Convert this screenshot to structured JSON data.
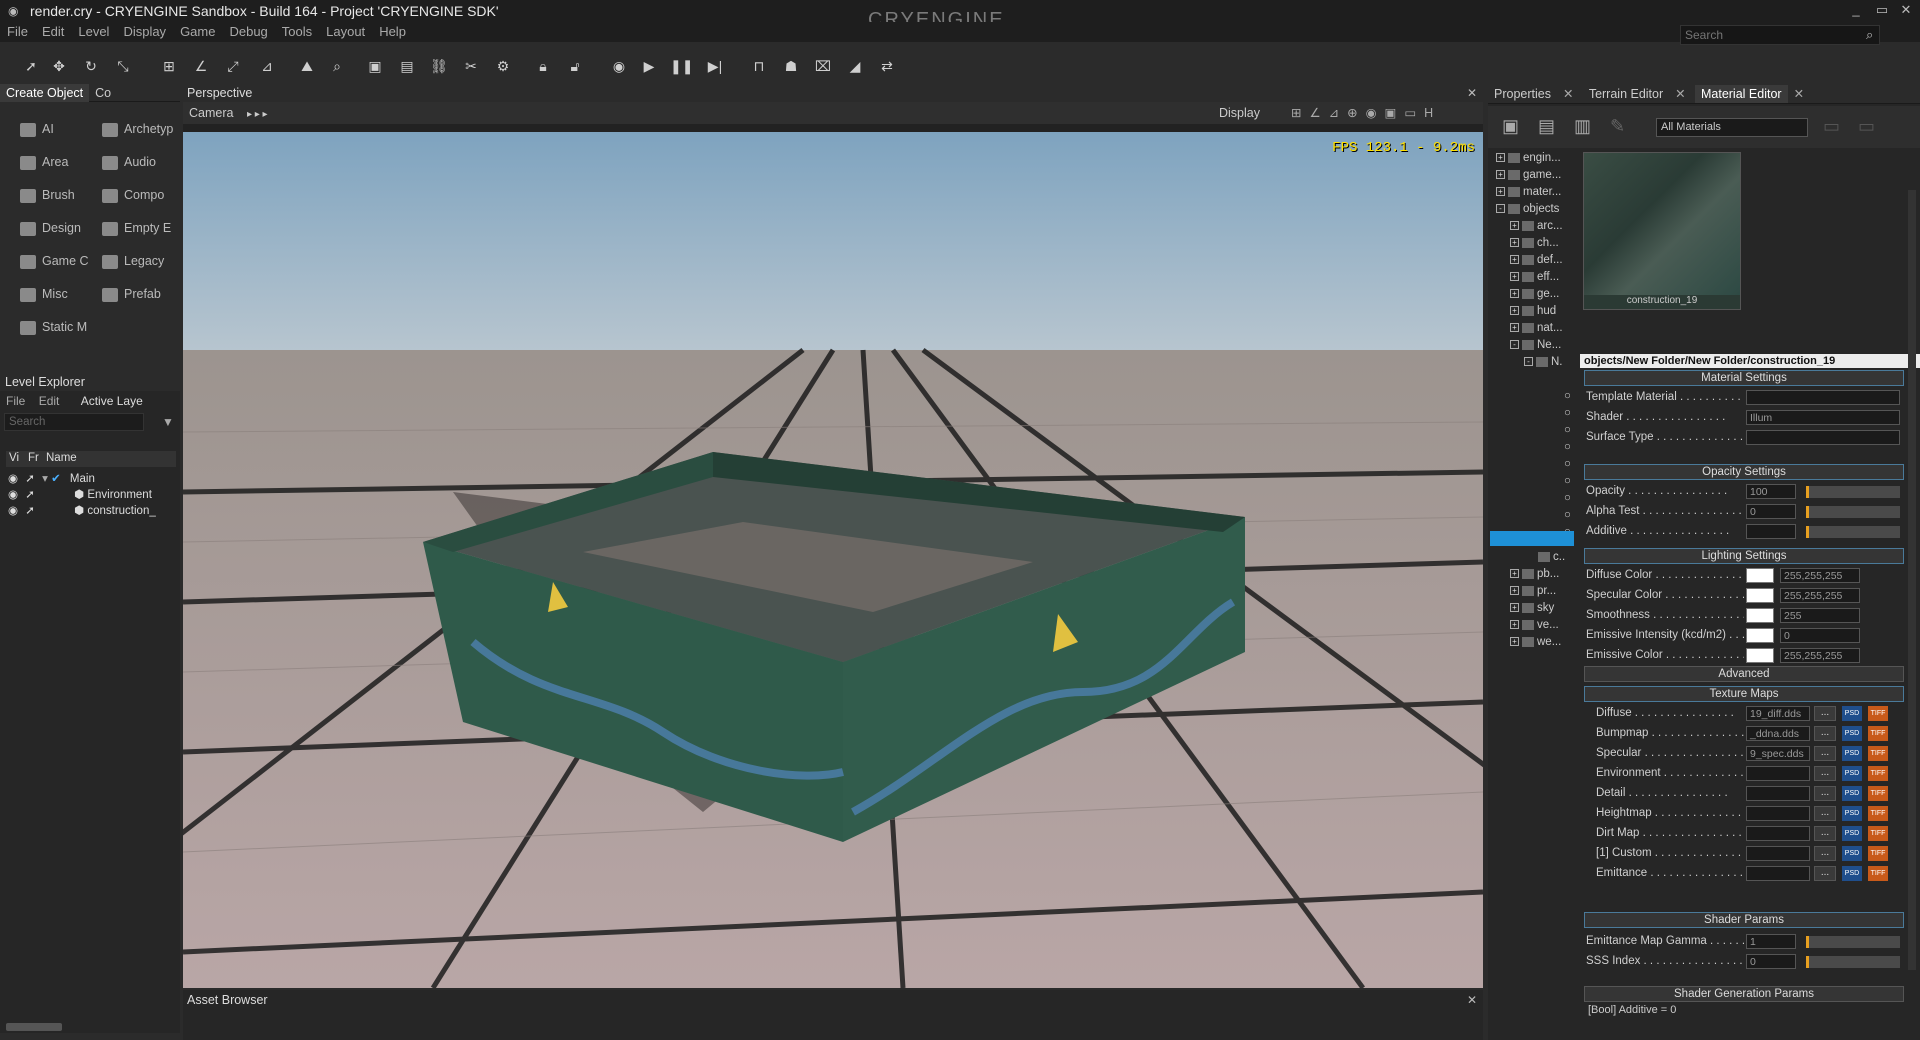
{
  "window": {
    "title": "render.cry - CRYENGINE Sandbox - Build 164 - Project 'CRYENGINE SDK'",
    "logo": "CRYENGINE",
    "minimize": "_",
    "maximize": "▭",
    "close": "✕"
  },
  "menu": [
    "File",
    "Edit",
    "Level",
    "Display",
    "Game",
    "Debug",
    "Tools",
    "Layout",
    "Help"
  ],
  "search": {
    "placeholder": "Search"
  },
  "create_object": {
    "tabs": [
      "Create Object",
      "Co"
    ],
    "items": [
      {
        "label": "AI",
        "icon": "ai-icon"
      },
      {
        "label": "Archetyp",
        "icon": "archetype-icon"
      },
      {
        "label": "Area",
        "icon": "area-icon"
      },
      {
        "label": "Audio",
        "icon": "audio-icon"
      },
      {
        "label": "Brush",
        "icon": "brush-icon"
      },
      {
        "label": "Compo",
        "icon": "component-icon"
      },
      {
        "label": "Design",
        "icon": "designer-icon"
      },
      {
        "label": "Empty E",
        "icon": "empty-entity-icon"
      },
      {
        "label": "Game C",
        "icon": "game-component-icon"
      },
      {
        "label": "Legacy",
        "icon": "legacy-icon"
      },
      {
        "label": "Misc",
        "icon": "misc-icon"
      },
      {
        "label": "Prefab",
        "icon": "prefab-icon"
      },
      {
        "label": "Static M",
        "icon": "static-mesh-icon"
      }
    ]
  },
  "level_explorer": {
    "title": "Level Explorer",
    "menu": [
      "File",
      "Edit"
    ],
    "active_layer": "Active Laye",
    "search_placeholder": "Search",
    "columns": [
      "Vi",
      "Fr",
      "Name"
    ],
    "rows": [
      "Main",
      "Environment",
      "construction_"
    ]
  },
  "viewport": {
    "title": "Perspective",
    "camera": "Camera",
    "display": "Display",
    "fps": "FPS 123.1 - 9.2ms"
  },
  "asset_browser": {
    "title": "Asset Browser"
  },
  "right_panel": {
    "tabs": [
      "Properties",
      "Terrain Editor",
      "Material Editor"
    ],
    "filter": "All Materials",
    "tree": [
      {
        "label": "engin...",
        "level": 0,
        "sign": "+"
      },
      {
        "label": "game...",
        "level": 0,
        "sign": "+"
      },
      {
        "label": "mater...",
        "level": 0,
        "sign": "+"
      },
      {
        "label": "objects",
        "level": 0,
        "sign": "-"
      },
      {
        "label": "arc...",
        "level": 1,
        "sign": "+"
      },
      {
        "label": "ch...",
        "level": 1,
        "sign": "+"
      },
      {
        "label": "def...",
        "level": 1,
        "sign": "+"
      },
      {
        "label": "eff...",
        "level": 1,
        "sign": "+"
      },
      {
        "label": "ge...",
        "level": 1,
        "sign": "+"
      },
      {
        "label": "hud",
        "level": 1,
        "sign": "+"
      },
      {
        "label": "nat...",
        "level": 1,
        "sign": "+"
      },
      {
        "label": "Ne...",
        "level": 1,
        "sign": "-"
      },
      {
        "label": "N.",
        "level": 2,
        "sign": "-"
      }
    ],
    "tree_bottom": [
      {
        "label": "c..",
        "level": 3,
        "sign": ""
      },
      {
        "label": "pb...",
        "level": 1,
        "sign": "+"
      },
      {
        "label": "pr...",
        "level": 1,
        "sign": "+"
      },
      {
        "label": "sky",
        "level": 1,
        "sign": "+"
      },
      {
        "label": "ve...",
        "level": 1,
        "sign": "+"
      },
      {
        "label": "we...",
        "level": 1,
        "sign": "+"
      }
    ],
    "preview_name": "construction_19",
    "material_path": "objects/New Folder/New Folder/construction_19",
    "sections": {
      "material": "Material Settings",
      "opacity": "Opacity Settings",
      "lighting": "Lighting Settings",
      "advanced": "Advanced",
      "texture": "Texture Maps",
      "shader_params": "Shader Params",
      "shader_gen": "Shader Generation Params"
    },
    "material_rows": [
      {
        "label": "Template Material",
        "value": ""
      },
      {
        "label": "Shader",
        "value": "Illum"
      },
      {
        "label": "Surface Type",
        "value": ""
      }
    ],
    "opacity_rows": [
      {
        "label": "Opacity",
        "value": "100"
      },
      {
        "label": "Alpha Test",
        "value": "0"
      },
      {
        "label": "Additive",
        "value": ""
      }
    ],
    "lighting_rows": [
      {
        "label": "Diffuse Color",
        "value": "255,255,255"
      },
      {
        "label": "Specular Color",
        "value": "255,255,255"
      },
      {
        "label": "Smoothness",
        "value": "255"
      },
      {
        "label": "Emissive Intensity (kcd/m2)",
        "value": "0"
      },
      {
        "label": "Emissive Color",
        "value": "255,255,255"
      }
    ],
    "texture_rows": [
      {
        "label": "Diffuse",
        "value": "19_diff.dds"
      },
      {
        "label": "Bumpmap",
        "value": "_ddna.dds"
      },
      {
        "label": "Specular",
        "value": "9_spec.dds"
      },
      {
        "label": "Environment",
        "value": ""
      },
      {
        "label": "Detail",
        "value": ""
      },
      {
        "label": "Heightmap",
        "value": ""
      },
      {
        "label": "Dirt Map",
        "value": ""
      },
      {
        "label": "[1] Custom",
        "value": ""
      },
      {
        "label": "Emittance",
        "value": ""
      }
    ],
    "shader_rows": [
      {
        "label": "Emittance Map Gamma",
        "value": "1"
      },
      {
        "label": "SSS Index",
        "value": "0"
      }
    ],
    "bool_additive": "[Bool] Additive = 0",
    "browse": "...",
    "psd": "PSD",
    "tif": "TIFF"
  }
}
